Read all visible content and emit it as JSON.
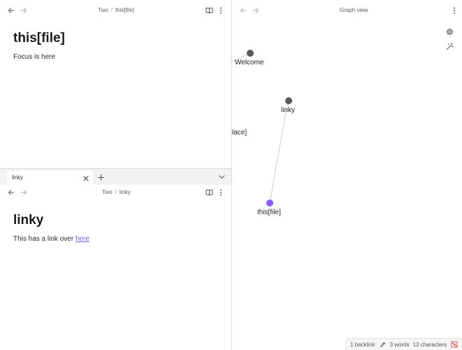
{
  "top_pane": {
    "breadcrumb": {
      "folder": "Two",
      "separator": "/",
      "file": "this[file]"
    },
    "title": "this[file]",
    "body": "Focus is here"
  },
  "bottom_pane": {
    "tab": {
      "label": "linky"
    },
    "breadcrumb": {
      "folder": "Two",
      "separator": "/",
      "file": "linky"
    },
    "title": "linky",
    "body_prefix": "This has a link over ",
    "link_text": "here"
  },
  "graph": {
    "title": "Graph view",
    "nodes": [
      {
        "label": "Welcome",
        "color": "#5a5a5a"
      },
      {
        "label": "linky",
        "color": "#5a5a5a"
      },
      {
        "label": "lace]"
      },
      {
        "label": "this[file]",
        "color": "#8b5cf6"
      }
    ]
  },
  "status_bar": {
    "backlinks": "1 backlink",
    "words": "3 words",
    "characters": "13 characters"
  },
  "colors": {
    "accent": "#7c5ce3",
    "active_node": "#8b5cf6",
    "node": "#5a5a5a",
    "edge": "#cfcfcf",
    "divider": "#dcdcdc"
  }
}
